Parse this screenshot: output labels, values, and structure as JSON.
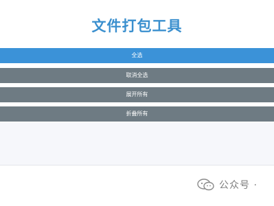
{
  "header": {
    "title": "文件打包工具"
  },
  "actions": {
    "select_all": "全选",
    "deselect_all": "取消全选",
    "expand_all": "展开所有",
    "collapse_all": "折叠所有"
  },
  "watermark": {
    "text": "公众号 ·",
    "icon": "wechat-icon"
  },
  "colors": {
    "title": "#3a8fce",
    "primary_button": "#3b92d8",
    "secondary_button": "#6e7b83",
    "panel_background": "#f6f7fb"
  }
}
